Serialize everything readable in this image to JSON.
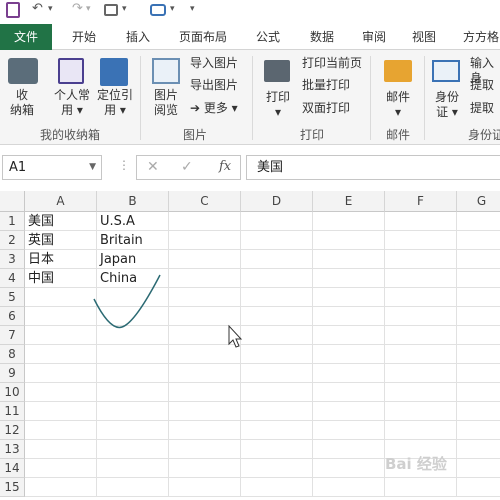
{
  "qat": {
    "undo": "↶",
    "redo": "↷",
    "more": "▾"
  },
  "tabs": [
    {
      "label": "文件"
    },
    {
      "label": "开始"
    },
    {
      "label": "插入"
    },
    {
      "label": "页面布局"
    },
    {
      "label": "公式"
    },
    {
      "label": "数据"
    },
    {
      "label": "审阅"
    },
    {
      "label": "视图"
    },
    {
      "label": "方方格"
    }
  ],
  "ribbon": {
    "favorites": {
      "btn1_line1": "收",
      "btn1_line2": "纳箱",
      "btn2_line1": "个人常",
      "btn2_line2": "用 ▾",
      "btn3_line1": "定位引",
      "btn3_line2": "用 ▾",
      "group": "我的收纳箱"
    },
    "image": {
      "browse_line1": "图片",
      "browse_line2": "阅览",
      "import": "导入图片",
      "export": "导出图片",
      "more": "➔ 更多 ▾",
      "group": "图片"
    },
    "print": {
      "print_line1": "打印",
      "print_line2": "▾",
      "current": "打印当前页",
      "batch": "批量打印",
      "duplex": "双面打印",
      "group": "打印"
    },
    "mail": {
      "mail_line1": "邮件",
      "mail_line2": "▾",
      "group": "邮件"
    },
    "idcard": {
      "id_line1": "身份",
      "id_line2": "证 ▾",
      "input": "输入身",
      "extract1": "提取",
      "extract2": "提取",
      "group": "身份证"
    }
  },
  "formula_bar": {
    "name_box": "A1",
    "cancel": "✕",
    "enter": "✓",
    "fx": "fx",
    "content": "美国"
  },
  "columns": [
    "A",
    "B",
    "C",
    "D",
    "E",
    "F",
    "G"
  ],
  "rows": [
    "1",
    "2",
    "3",
    "4",
    "5",
    "6",
    "7",
    "8",
    "9",
    "10",
    "11",
    "12",
    "13",
    "14",
    "15"
  ],
  "cells": [
    {
      "a": "美国",
      "b": "U.S.A"
    },
    {
      "a": "英国",
      "b": "Britain"
    },
    {
      "a": "日本",
      "b": "Japan"
    },
    {
      "a": "中国",
      "b": "China"
    }
  ],
  "colors": {
    "file_tab": "#217346",
    "annotation": "#2b6a73"
  },
  "watermark": "Bai 经验"
}
